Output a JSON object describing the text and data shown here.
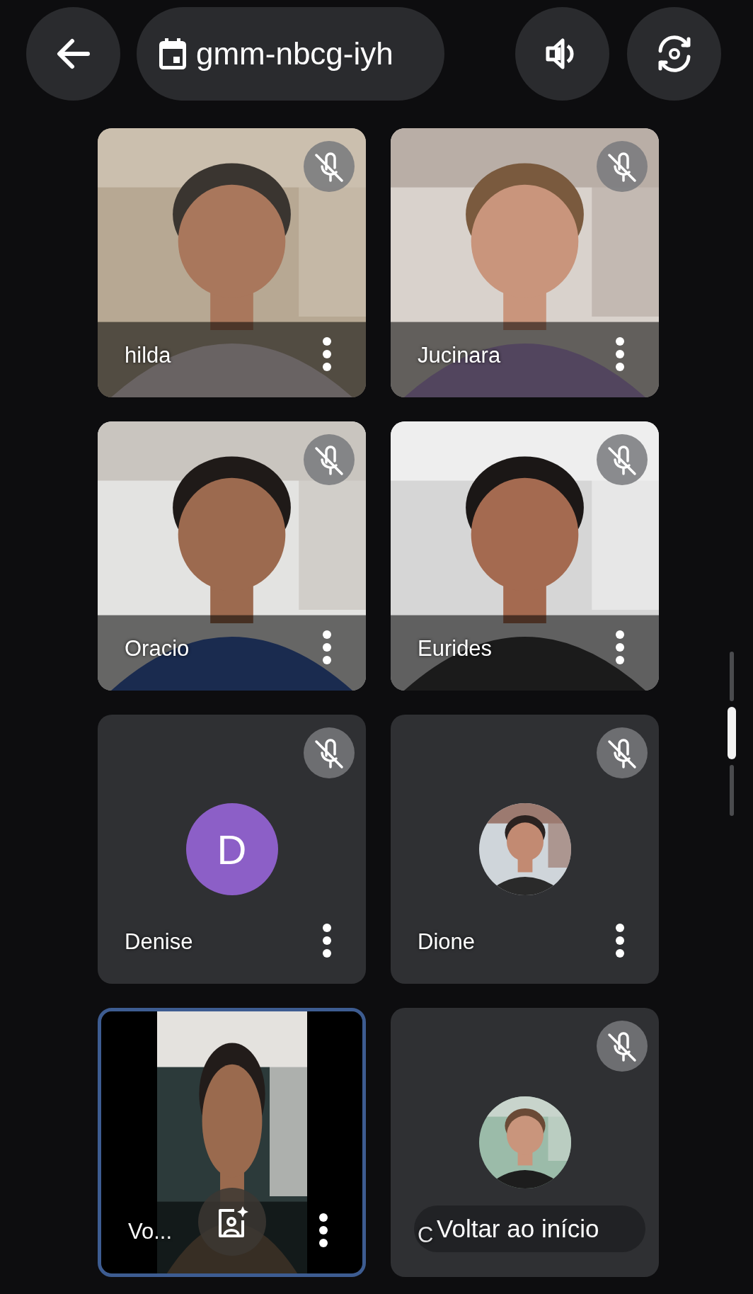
{
  "top_bar": {
    "meeting_code": "gmm-nbcg-iyh"
  },
  "tiles": [
    {
      "name": "hilda",
      "kind": "video",
      "muted": true,
      "selected": false
    },
    {
      "name": "Jucinara",
      "kind": "video",
      "muted": true,
      "selected": false
    },
    {
      "name": "Oracio",
      "kind": "video",
      "muted": true,
      "selected": false
    },
    {
      "name": "Eurides",
      "kind": "video",
      "muted": true,
      "selected": false
    },
    {
      "name": "Denise",
      "kind": "letter",
      "letter": "D",
      "muted": true,
      "selected": false
    },
    {
      "name": "Dione",
      "muted": true,
      "selected": false
    },
    {
      "name": "Vo...",
      "kind": "self",
      "muted": false,
      "selected": true
    },
    {
      "name": "C",
      "muted": true,
      "selected": false
    }
  ],
  "toast": {
    "text": "Voltar ao início"
  }
}
